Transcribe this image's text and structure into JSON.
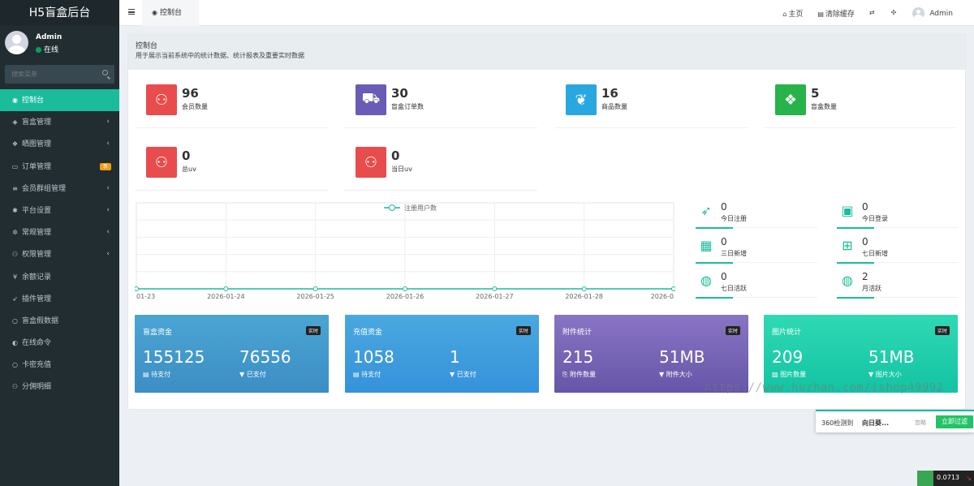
{
  "app": {
    "title": "H5盲盒后台"
  },
  "user": {
    "name": "Admin",
    "status": "在线"
  },
  "sidebar": {
    "search_placeholder": "搜索菜单",
    "items": [
      {
        "label": "控制台",
        "icon": "dashboard-icon",
        "glyph": "◉",
        "active": true,
        "arrow": false
      },
      {
        "label": "盲盒管理",
        "icon": "cube-icon",
        "glyph": "◈",
        "arrow": true
      },
      {
        "label": "晒图管理",
        "icon": "dropbox-icon",
        "glyph": "❖",
        "arrow": true
      },
      {
        "label": "订单管理",
        "icon": "cart-icon",
        "glyph": "▭",
        "badge": "新"
      },
      {
        "label": "会员群组管理",
        "icon": "list-icon",
        "glyph": "≡",
        "arrow": true
      },
      {
        "label": "平台设置",
        "icon": "cog-icon",
        "glyph": "✱",
        "arrow": true
      },
      {
        "label": "常规管理",
        "icon": "cogs-icon",
        "glyph": "✲",
        "arrow": true
      },
      {
        "label": "权限管理",
        "icon": "group-icon",
        "glyph": "⚇",
        "arrow": true
      },
      {
        "label": "余额记录",
        "icon": "yen-icon",
        "glyph": "¥"
      },
      {
        "label": "插件管理",
        "icon": "rocket-icon",
        "glyph": "➶"
      },
      {
        "label": "盲盒假数据",
        "icon": "circle-icon",
        "glyph": "○"
      },
      {
        "label": "在线命令",
        "icon": "adjust-icon",
        "glyph": "◐"
      },
      {
        "label": "卡密充值",
        "icon": "circle-icon",
        "glyph": "○"
      },
      {
        "label": "分佣明细",
        "icon": "group-icon",
        "glyph": "⚇"
      }
    ]
  },
  "topbar": {
    "tab_label": "控制台",
    "home": "主页",
    "clear_cache": "清除缓存",
    "user": "Admin"
  },
  "dashboard": {
    "title": "控制台",
    "subtitle": "用于展示当前系统中的统计数据、统计报表及重要实时数据"
  },
  "stats": [
    {
      "value": "96",
      "label": "会员数量",
      "color": "#e84c4c",
      "icon": "users-icon"
    },
    {
      "value": "30",
      "label": "盲盒订单数",
      "color": "#6a5bb6",
      "icon": "cart-icon"
    },
    {
      "value": "16",
      "label": "商品数量",
      "color": "#29a8e0",
      "icon": "leaf-icon"
    },
    {
      "value": "5",
      "label": "盲盒数量",
      "color": "#27b24a",
      "icon": "dropbox-icon"
    },
    {
      "value": "0",
      "label": "总uv",
      "color": "#e84c4c",
      "icon": "users-icon"
    },
    {
      "value": "0",
      "label": "当日uv",
      "color": "#e84c4c",
      "icon": "users-icon"
    }
  ],
  "chart_data": {
    "type": "line",
    "x": [
      "01-23",
      "2026-01-24",
      "2026-01-25",
      "2026-01-26",
      "2026-01-27",
      "2026-01-28",
      "2026-0"
    ],
    "series": [
      {
        "name": "注册用户数",
        "values": [
          0,
          0,
          0,
          0,
          0,
          0,
          0
        ],
        "color": "#1abc9c"
      }
    ],
    "grid": true,
    "legend": "top-center"
  },
  "mini_stats": [
    {
      "value": "0",
      "label": "今日注册",
      "icon": "rocket-icon",
      "glyph": "➶"
    },
    {
      "value": "0",
      "label": "今日登录",
      "icon": "vcard-icon",
      "glyph": "▣"
    },
    {
      "value": "0",
      "label": "三日新增",
      "icon": "calendar-icon",
      "glyph": "▦"
    },
    {
      "value": "0",
      "label": "七日新增",
      "icon": "calendar-plus-icon",
      "glyph": "⊞"
    },
    {
      "value": "0",
      "label": "七日活跃",
      "icon": "user-circle-icon",
      "glyph": "◍"
    },
    {
      "value": "2",
      "label": "月活跃",
      "icon": "user-circle-icon",
      "glyph": "◍"
    }
  ],
  "cards": [
    {
      "title": "盲盒资金",
      "tag": "实时",
      "v1": "155125",
      "l1": "待支付",
      "v2": "76556",
      "l2": "已支付",
      "bg": "linear-gradient(180deg,#4ba5d3,#3b8ec4)"
    },
    {
      "title": "充值资金",
      "tag": "实时",
      "v1": "1058",
      "l1": "待支付",
      "v2": "1",
      "l2": "已支付",
      "bg": "linear-gradient(180deg,#4aa8df,#3592db)"
    },
    {
      "title": "附件统计",
      "tag": "实时",
      "v1": "215",
      "l1": "附件数量",
      "v2": "51MB",
      "l2": "附件大小",
      "bg": "linear-gradient(180deg,#8a74c4,#6656a8)"
    },
    {
      "title": "图片统计",
      "tag": "实时",
      "v1": "209",
      "l1": "图片数量",
      "v2": "51MB",
      "l2": "图片大小",
      "bg": "linear-gradient(180deg,#2fd9b4,#14c3a3)"
    }
  ],
  "watermark": "https://www.huzhan.com/ishop49992",
  "popup": {
    "prefix": "360检测到",
    "name": "向日葵...",
    "ignore": "忽略",
    "button": "立即过滤"
  },
  "corner": {
    "value": "0.0713"
  }
}
